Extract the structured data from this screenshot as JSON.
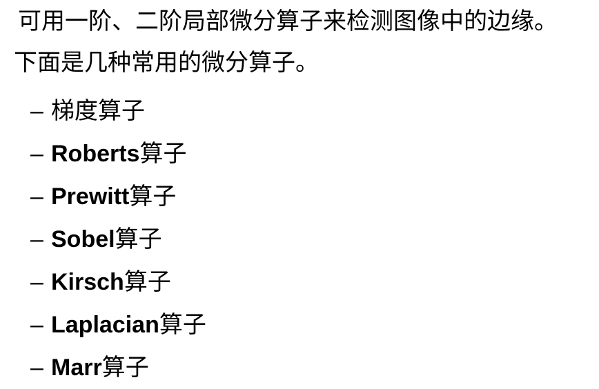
{
  "intro": {
    "line1": "可用一阶、二阶局部微分算子来检测图像中的边缘。",
    "line2": "下面是几种常用的微分算子。"
  },
  "bullet_marker": "–",
  "operators": [
    {
      "name": "",
      "suffix": "梯度算子"
    },
    {
      "name": "Roberts",
      "suffix": "算子"
    },
    {
      "name": "Prewitt",
      "suffix": "算子"
    },
    {
      "name": "Sobel",
      "suffix": "算子"
    },
    {
      "name": "Kirsch",
      "suffix": "算子"
    },
    {
      "name": "Laplacian",
      "suffix": "算子"
    },
    {
      "name": "Marr",
      "suffix": "算子"
    }
  ]
}
